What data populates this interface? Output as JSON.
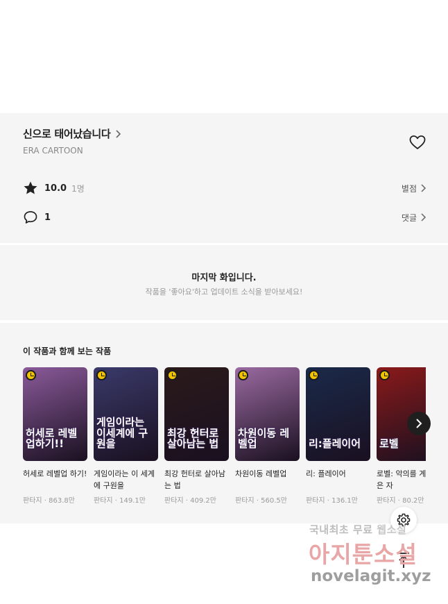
{
  "work": {
    "title": "신으로 태어났습니다",
    "author": "ERA CARTOON",
    "rating_score": "10.0",
    "rating_count": "1명",
    "rating_link": "별점",
    "comment_count": "1",
    "comment_link": "댓글"
  },
  "last_episode": {
    "title": "마지막 화입니다.",
    "subtitle": "작품을 '좋아요'하고 업데이트 소식을 받아보세요!"
  },
  "recommendations": {
    "heading": "이 작품과 함께 보는 작품",
    "items": [
      {
        "title": "허세로 레벨업 하기!",
        "meta": "판타지 · 863.8만",
        "cover_text": "허세로 레벨업하기!!",
        "bg": "#8a5a9a"
      },
      {
        "title": "게임이라는 이 세계에 구원을",
        "meta": "판타지 · 149.1만",
        "cover_text": "게임이라는 이세계에 구원을",
        "bg": "#3a3a6a"
      },
      {
        "title": "최강 헌터로 살아남는 법",
        "meta": "판타지 · 409.2만",
        "cover_text": "최강 헌터로 살아남는 법",
        "bg": "#2a1a1a"
      },
      {
        "title": "차원이동 레벨업",
        "meta": "판타지 · 560.5만",
        "cover_text": "차원이동 레벨업",
        "bg": "#9a6aa0"
      },
      {
        "title": "리: 플레이어",
        "meta": "판타지 · 136.1만",
        "cover_text": "리:플레이어",
        "bg": "#1a2a4a"
      },
      {
        "title": "로벨: 악의를 계승받은 자",
        "meta": "판타지 · 80.2만",
        "cover_text": "로벨",
        "bg": "#8a1a1a"
      }
    ]
  },
  "watermark": {
    "line1": "국내최초 무료",
    "line1_hl": "웹소설",
    "line2": "아지툰소설",
    "line3": "novelagit.xyz"
  }
}
